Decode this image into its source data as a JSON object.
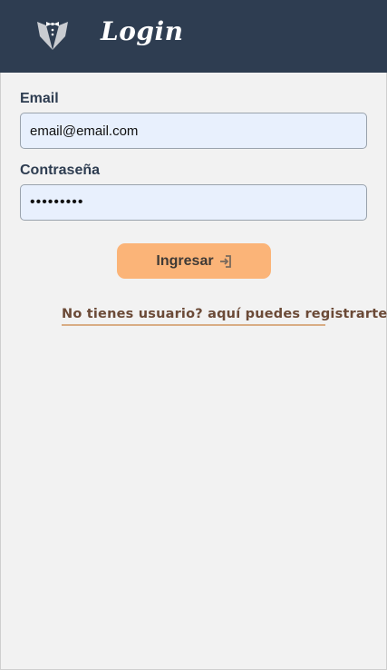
{
  "header": {
    "logo_icon": "tuxedo-bowtie-icon",
    "title": "Login"
  },
  "form": {
    "email_label": "Email",
    "email_value": "email@email.com",
    "password_label": "Contraseña",
    "password_value": "123456789",
    "submit_label": "Ingresar",
    "submit_icon": "sign-in-icon"
  },
  "register_link": "No tienes usuario? aquí puedes registrarte",
  "colors": {
    "header_bg": "#2e3d51",
    "page_bg": "#f2f2f2",
    "input_bg": "#e8f0fd",
    "button_bg": "#fbb478",
    "link_text": "#6b4a37",
    "link_underline": "#d9ad85"
  }
}
